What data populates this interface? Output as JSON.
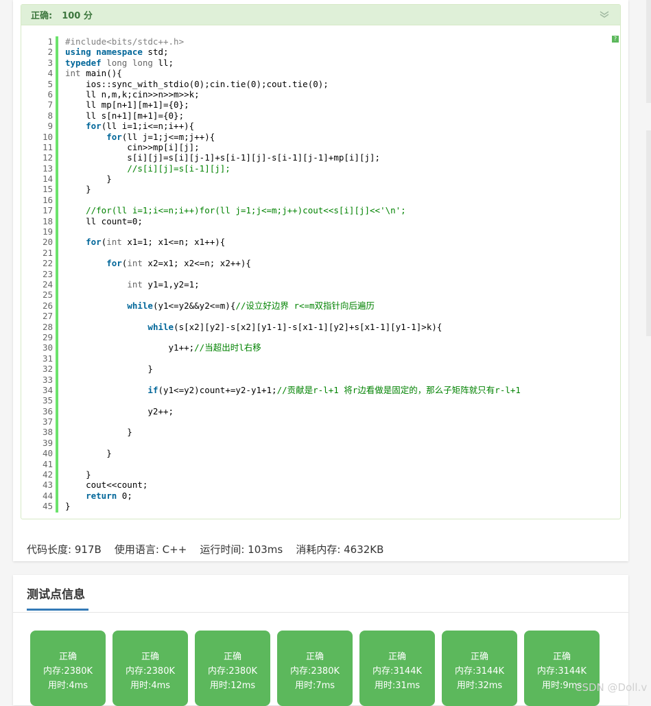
{
  "result": {
    "status": "正确:",
    "score": "100 分"
  },
  "colors": {
    "accent_green": "#5cb85c",
    "header_bg": "#dff0d8",
    "header_text": "#3c763d",
    "tab_underline": "#337ab7"
  },
  "code": {
    "lines": [
      "#include<bits/stdc++.h>",
      "using namespace std;",
      "typedef long long ll;",
      "int main(){",
      "    ios::sync_with_stdio(0);cin.tie(0);cout.tie(0);",
      "    ll n,m,k;cin>>n>>m>>k;",
      "    ll mp[n+1][m+1]={0};",
      "    ll s[n+1][m+1]={0};",
      "    for(ll i=1;i<=n;i++){",
      "        for(ll j=1;j<=m;j++){",
      "            cin>>mp[i][j];",
      "            s[i][j]=s[i][j-1]+s[i-1][j]-s[i-1][j-1]+mp[i][j];",
      "            //s[i][j]=s[i-1][j];",
      "        }",
      "    }",
      "",
      "    //for(ll i=1;i<=n;i++)for(ll j=1;j<=m;j++)cout<<s[i][j]<<'\\n';",
      "    ll count=0;",
      "",
      "    for(int x1=1; x1<=n; x1++){",
      "",
      "        for(int x2=x1; x2<=n; x2++){",
      "",
      "            int y1=1,y2=1;",
      "",
      "            while(y1<=y2&&y2<=m){//设立好边界 r<=m双指针向后遍历",
      "",
      "                while(s[x2][y2]-s[x2][y1-1]-s[x1-1][y2]+s[x1-1][y1-1]>k){",
      "",
      "                    y1++;//当超出时l右移",
      "",
      "                }",
      "",
      "                if(y1<=y2)count+=y2-y1+1;//贡献是r-l+1 将r边看做是固定的，那么子矩阵就只有r-l+1",
      "",
      "                y2++;",
      "",
      "            }",
      "",
      "        }",
      "",
      "    }",
      "    cout<<count;",
      "    return 0;",
      "}"
    ]
  },
  "stats": {
    "code_length": "代码长度: 917B",
    "language": "使用语言: C++",
    "run_time": "运行时间: 103ms",
    "memory": "消耗内存: 4632KB"
  },
  "tests": {
    "title": "测试点信息",
    "cases": [
      {
        "status": "正确",
        "memory": "内存:2380K",
        "time": "用时:4ms"
      },
      {
        "status": "正确",
        "memory": "内存:2380K",
        "time": "用时:4ms"
      },
      {
        "status": "正确",
        "memory": "内存:2380K",
        "time": "用时:12ms"
      },
      {
        "status": "正确",
        "memory": "内存:2380K",
        "time": "用时:7ms"
      },
      {
        "status": "正确",
        "memory": "内存:3144K",
        "time": "用时:31ms"
      },
      {
        "status": "正确",
        "memory": "内存:3144K",
        "time": "用时:32ms"
      },
      {
        "status": "正确",
        "memory": "内存:3144K",
        "time": "用时:9ms"
      }
    ]
  },
  "watermark": "CSDN @Doll.v",
  "icons": {
    "collapse": "double-chevron-down-icon",
    "help": "question-mark-icon"
  }
}
